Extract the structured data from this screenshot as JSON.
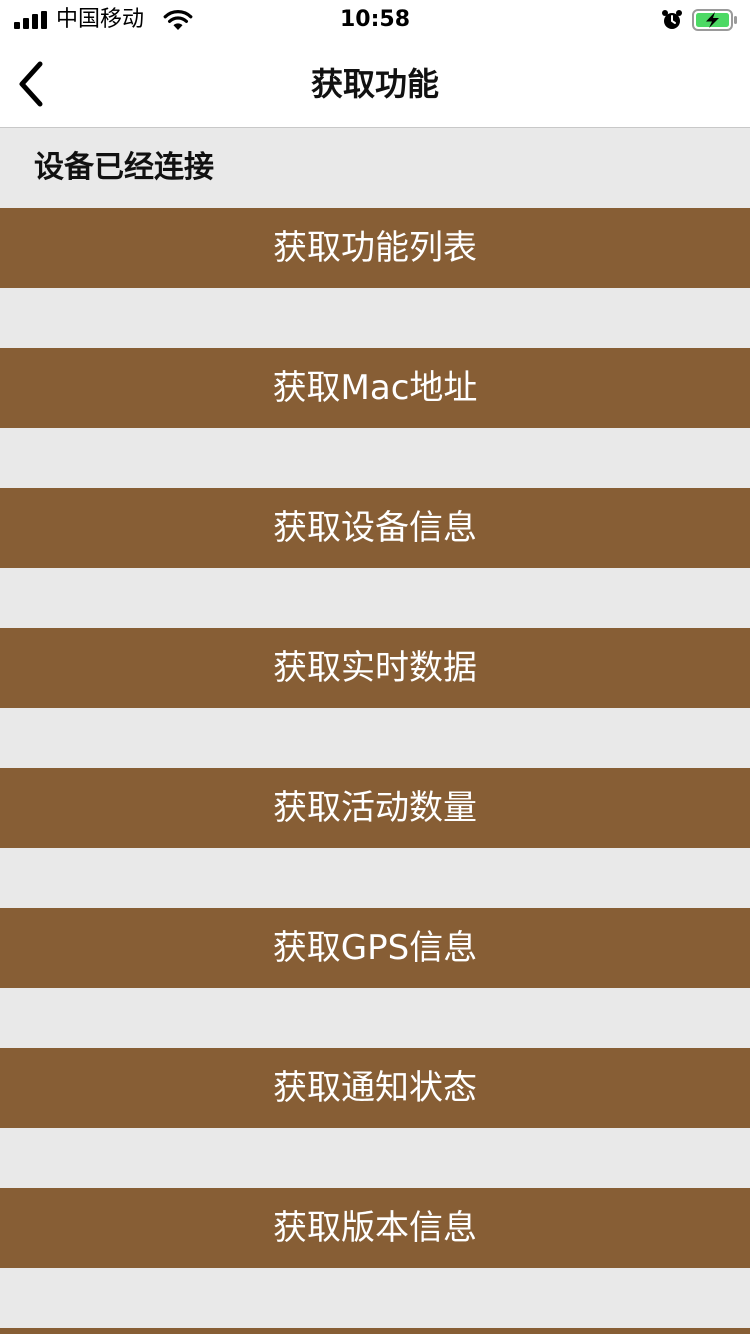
{
  "status_bar": {
    "carrier": "中国移动",
    "time": "10:58",
    "signal_icon": "cellular-signal-icon",
    "wifi_icon": "wifi-icon",
    "alarm_icon": "alarm-clock-icon",
    "battery_icon": "battery-charging-icon",
    "battery_color": "#4cd964"
  },
  "nav": {
    "title": "获取功能",
    "back_icon": "chevron-left-icon"
  },
  "connection": {
    "status_text": "设备已经连接"
  },
  "accent_color": "#875e35",
  "background_color": "#e9e9e9",
  "actions": [
    {
      "label": "获取功能列表"
    },
    {
      "label": "获取Mac地址"
    },
    {
      "label": "获取设备信息"
    },
    {
      "label": "获取实时数据"
    },
    {
      "label": "获取活动数量"
    },
    {
      "label": "获取GPS信息"
    },
    {
      "label": "获取通知状态"
    },
    {
      "label": "获取版本信息"
    },
    {
      "label": ""
    }
  ]
}
